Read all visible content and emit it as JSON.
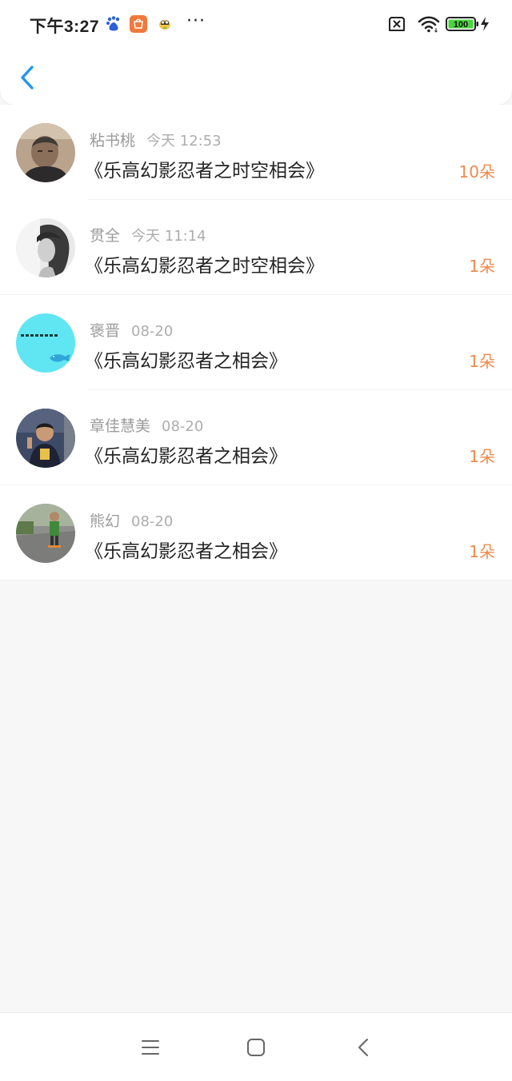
{
  "status_bar": {
    "time": "下午3:27",
    "more": "···",
    "battery_level": "100",
    "icons": [
      "baidu-icon",
      "mi-store-icon",
      "bee-icon",
      "no-sim-icon",
      "wifi-icon",
      "battery-icon",
      "charging-icon"
    ]
  },
  "header": {
    "back_icon": "chevron-left-icon"
  },
  "gifts": [
    {
      "name": "粘书桃",
      "time": "今天 12:53",
      "title": "《乐高幻影忍者之时空相会》",
      "count": "10朵"
    },
    {
      "name": "贯全",
      "time": "今天 11:14",
      "title": "《乐高幻影忍者之时空相会》",
      "count": "1朵"
    },
    {
      "name": "褒晋",
      "time": "08-20",
      "title": "《乐高幻影忍者之相会》",
      "count": "1朵"
    },
    {
      "name": "章佳慧美",
      "time": "08-20",
      "title": "《乐高幻影忍者之相会》",
      "count": "1朵"
    },
    {
      "name": "熊幻",
      "time": "08-20",
      "title": "《乐高幻影忍者之相会》",
      "count": "1朵"
    }
  ],
  "colors": {
    "accent": "#2196f3",
    "count": "#ee8a4c",
    "background": "#f8f7f8"
  },
  "nav": {
    "icons": [
      "menu-icon",
      "home-icon",
      "back-icon"
    ]
  }
}
